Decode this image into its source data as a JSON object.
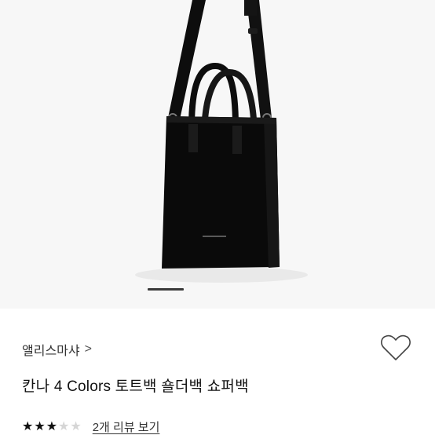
{
  "product": {
    "brand": "앨리스마샤",
    "brand_chevron": ">",
    "title": "칸나 4 Colors 토트백 숄더백 쇼퍼백",
    "rating": {
      "filled": 3,
      "total": 5
    },
    "review_link": "2개 리뷰 보기"
  },
  "gallery": {
    "slide_index": 1,
    "indicator_color": "#3a3a3a",
    "background": "#f7f7f7"
  },
  "icons": {
    "wishlist": "heart-outline-icon",
    "star_filled": "★",
    "star_empty": "★"
  },
  "colors": {
    "text": "#111111",
    "star_on": "#111111",
    "star_off": "#d6d6d6"
  }
}
